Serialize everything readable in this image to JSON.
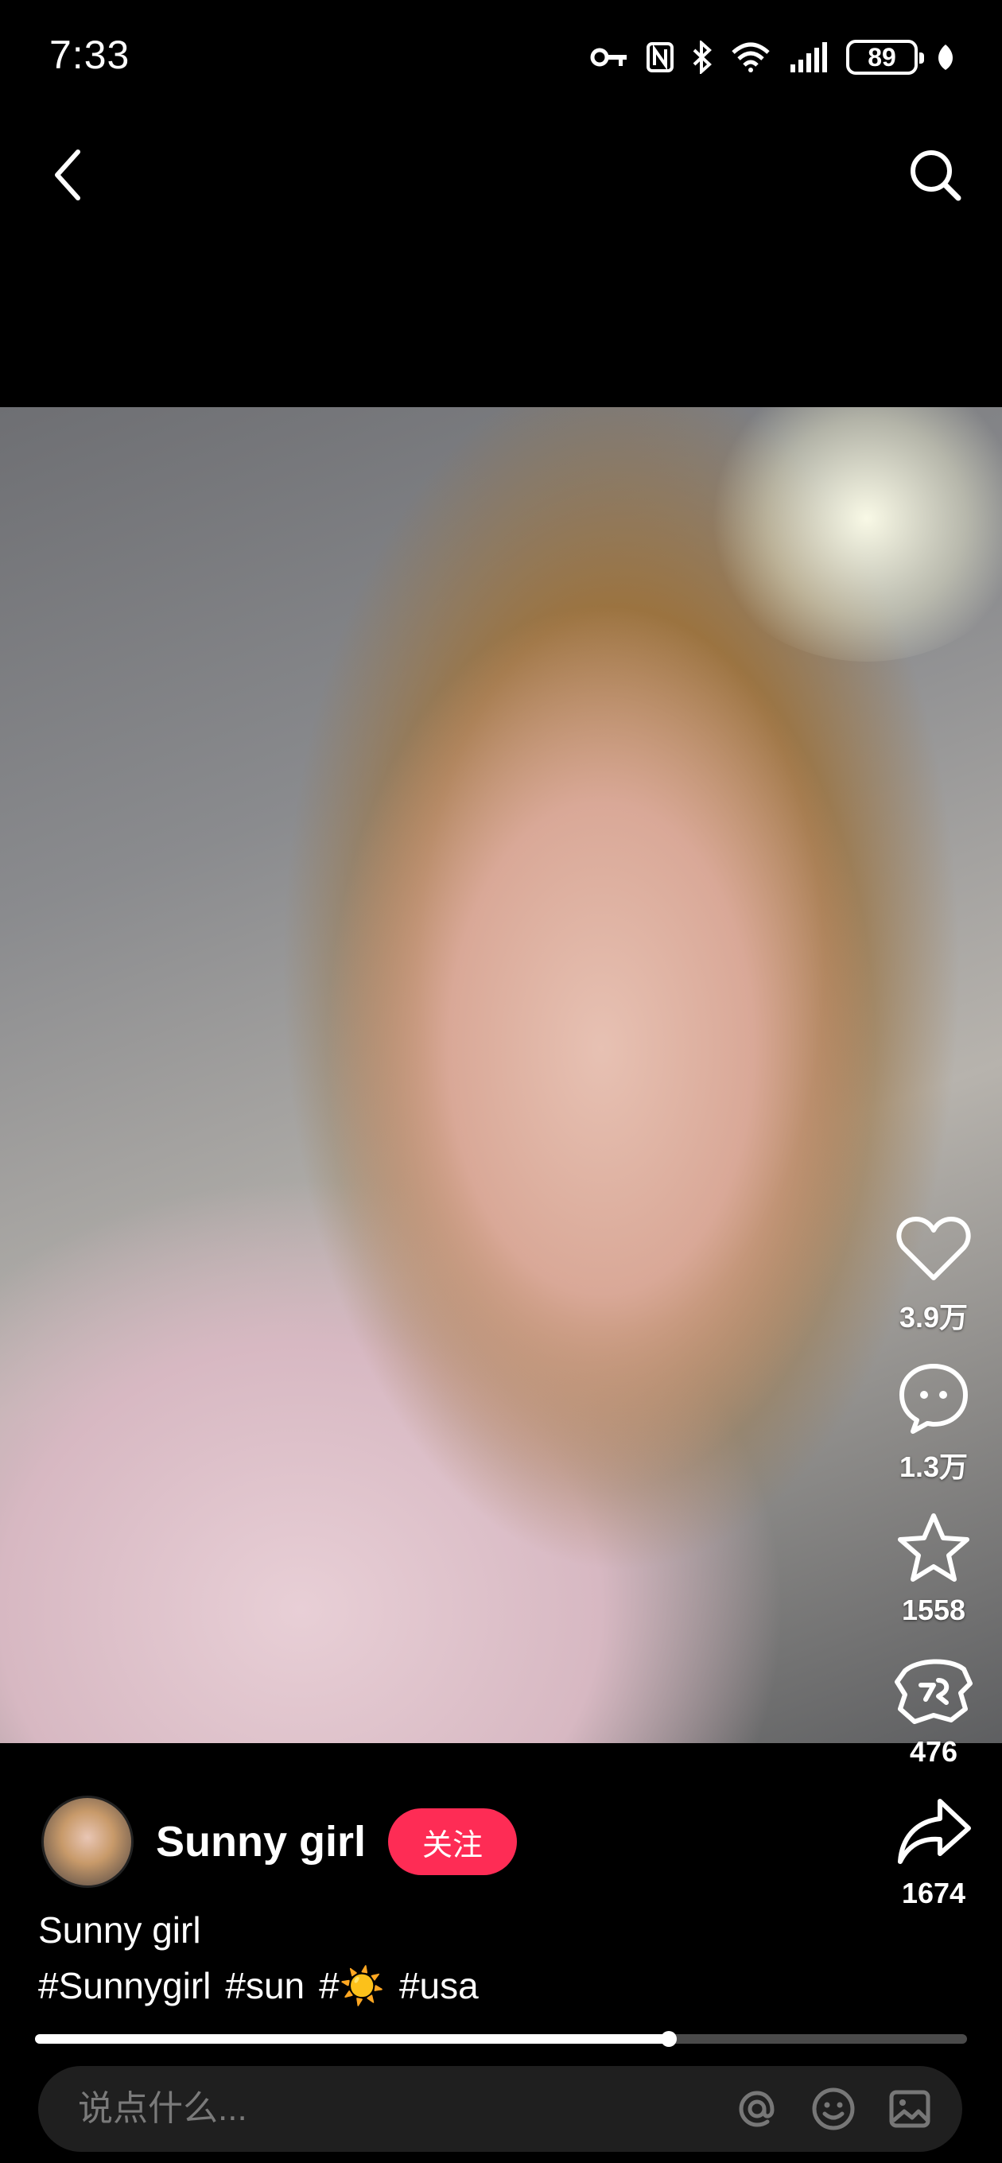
{
  "status_bar": {
    "time": "7:33",
    "battery": "89",
    "icons": [
      "key-icon",
      "nfc-icon",
      "bluetooth-icon",
      "wifi-icon",
      "signal-icon",
      "battery-icon",
      "leaf-icon"
    ]
  },
  "nav": {
    "back_icon": "chevron-left-icon",
    "search_icon": "search-icon"
  },
  "actions": {
    "like": {
      "icon": "heart-icon",
      "count": "3.9万"
    },
    "comment": {
      "icon": "comment-icon",
      "count": "1.3万"
    },
    "favorite": {
      "icon": "star-icon",
      "count": "1558"
    },
    "gift": {
      "icon": "gift-icon",
      "count": "476"
    },
    "share": {
      "icon": "share-icon",
      "count": "1674"
    }
  },
  "author": {
    "name": "Sunny girl",
    "follow_label": "关注"
  },
  "caption": "Sunny girl",
  "hashtags": [
    "#Sunnygirl",
    "#sun",
    "#☀️",
    "#usa"
  ],
  "progress": {
    "fraction": 0.68
  },
  "comment_bar": {
    "placeholder": "说点什么...",
    "icons": [
      "at-icon",
      "emoji-icon",
      "image-icon"
    ]
  },
  "colors": {
    "follow_button": "#fe2c55",
    "background": "#000000"
  }
}
